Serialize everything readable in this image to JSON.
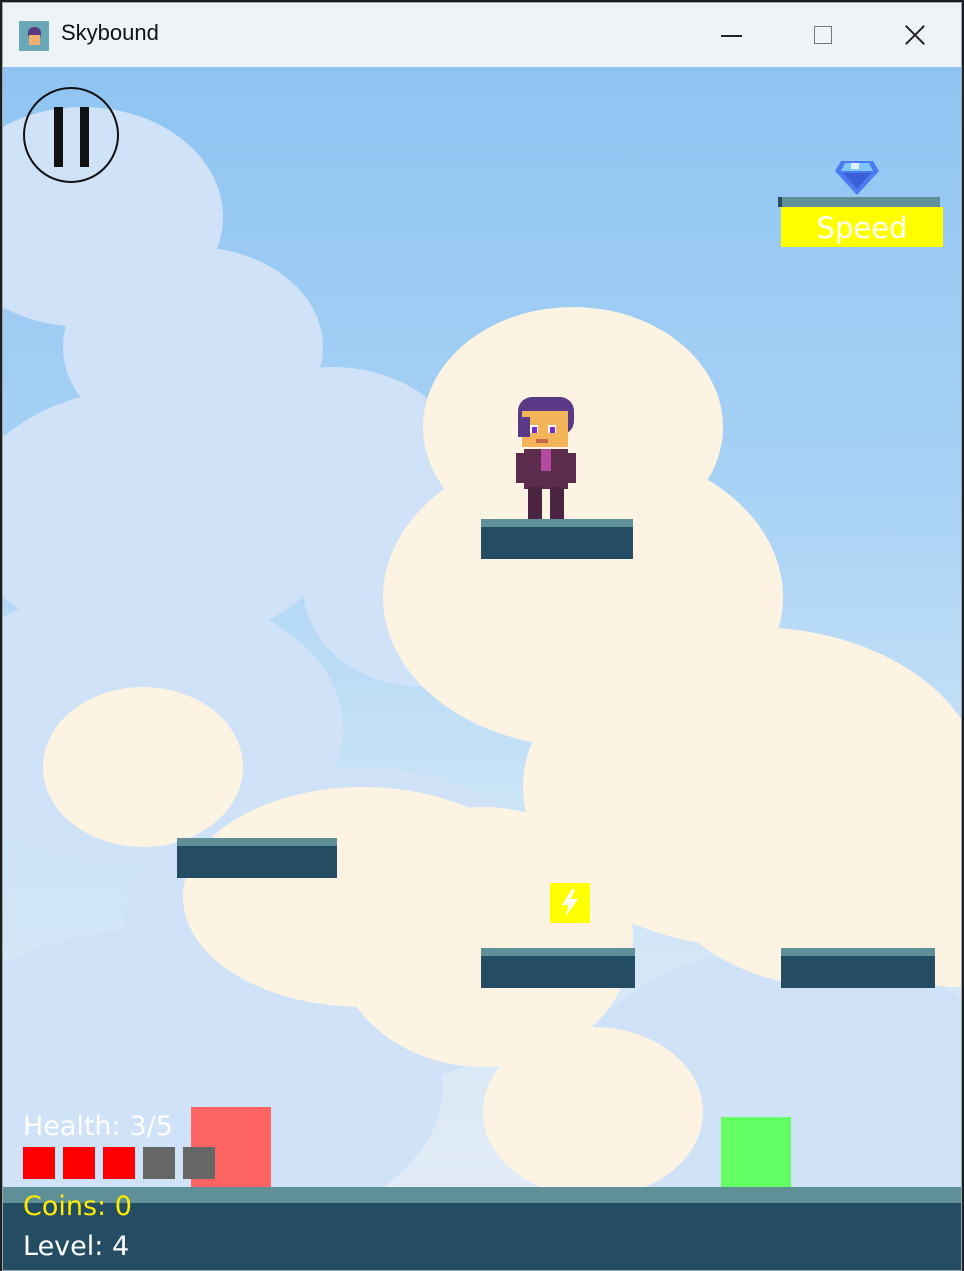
{
  "window": {
    "title": "Skybound",
    "controls": [
      "minimize",
      "maximize",
      "close"
    ]
  },
  "hud": {
    "health_text": "Health: 3/5",
    "health_current": 3,
    "health_max": 5,
    "health_colors": {
      "filled": "#ff0000",
      "empty": "#666666"
    },
    "coins_text": "Coins: 0",
    "level_text": "Level: 4"
  },
  "powerup": {
    "label": "Speed",
    "icon": "gem-icon",
    "color": "#ffff00"
  },
  "pickup": {
    "icon": "lightning-bolt-icon",
    "color": "#ffff00"
  },
  "colors": {
    "platform_top": "#5f9097",
    "platform_body": "#244d63",
    "enemy_red": "#ff6464",
    "enemy_green": "#64ff64",
    "coins_text": "#ffea00"
  }
}
